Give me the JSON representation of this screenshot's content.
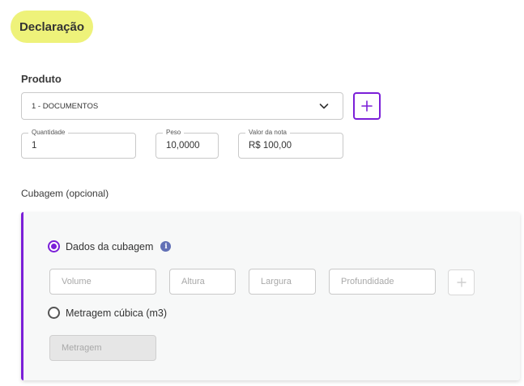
{
  "section": {
    "title": "Declaração"
  },
  "produto": {
    "label": "Produto",
    "selected": "1 - DOCUMENTOS",
    "add_icon": "plus-icon",
    "chevron_icon": "chevron-down-icon"
  },
  "fields": {
    "quantidade": {
      "label": "Quantidade",
      "value": "1"
    },
    "peso": {
      "label": "Peso",
      "value": "10,0000"
    },
    "valor": {
      "label": "Valor da nota",
      "value": "R$ 100,00"
    }
  },
  "cubagem": {
    "label": "Cubagem (opcional)",
    "option_dados": {
      "label": "Dados da cubagem",
      "selected": true
    },
    "info_icon": "i",
    "placeholders": {
      "volume": "Volume",
      "altura": "Altura",
      "largura": "Largura",
      "profundidade": "Profundidade"
    },
    "option_metragem": {
      "label": "Metragem cúbica (m3)",
      "selected": false
    },
    "metragem_placeholder": "Metragem"
  },
  "colors": {
    "accent": "#7b1fd8",
    "pill": "#eef27a",
    "info": "#6270b6"
  }
}
